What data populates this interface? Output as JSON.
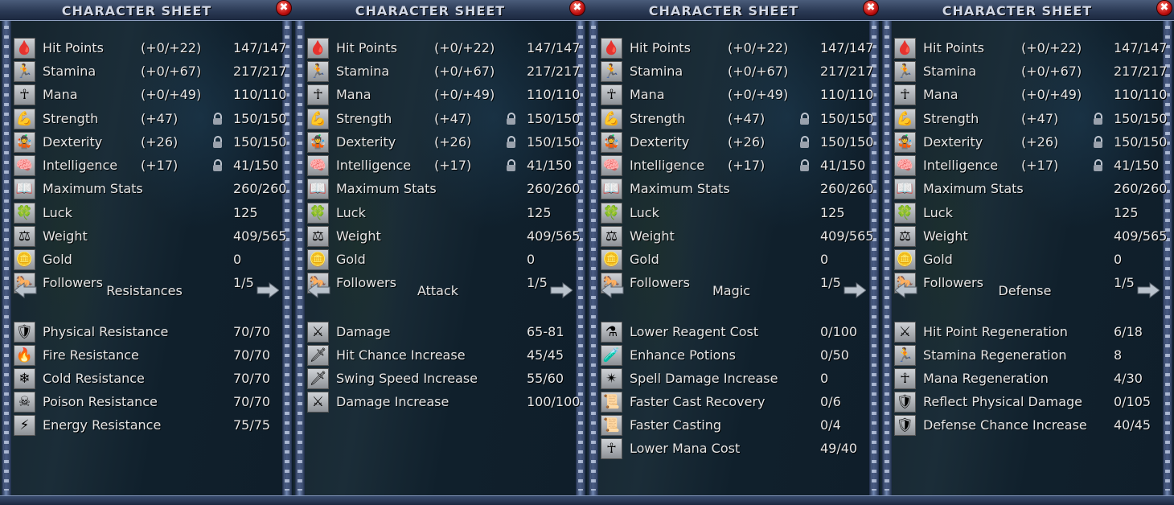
{
  "title": "CHARACTER SHEET",
  "close_symbol": "✖",
  "panels": [
    {
      "stats": [
        {
          "icon": "blood-drop-icon",
          "glyph": "🩸",
          "label": "Hit Points",
          "mod": "(+0/+22)",
          "value": "147/147"
        },
        {
          "icon": "running-figure-icon",
          "glyph": "🏃",
          "label": "Stamina",
          "mod": "(+0/+67)",
          "value": "217/217"
        },
        {
          "icon": "ankh-icon",
          "glyph": "☥",
          "label": "Mana",
          "mod": "(+0/+49)",
          "value": "110/110"
        },
        {
          "icon": "flexed-arm-icon",
          "glyph": "💪",
          "label": "Strength",
          "mod": "(+47)",
          "lock": true,
          "value": "150/150"
        },
        {
          "icon": "juggling-hands-icon",
          "glyph": "🤹",
          "label": "Dexterity",
          "mod": "(+26)",
          "lock": true,
          "value": "150/150"
        },
        {
          "icon": "brain-icon",
          "glyph": "🧠",
          "label": "Intelligence",
          "mod": "(+17)",
          "lock": true,
          "value": "41/150"
        },
        {
          "icon": "open-book-icon",
          "glyph": "📖",
          "label": "Maximum Stats",
          "mod": "",
          "value": "260/260"
        },
        {
          "icon": "four-leaf-clover-icon",
          "glyph": "🍀",
          "label": "Luck",
          "mod": "",
          "value": "125"
        },
        {
          "icon": "weight-icon",
          "glyph": "⚖",
          "label": "Weight",
          "mod": "",
          "value": "409/565"
        },
        {
          "icon": "gold-coins-icon",
          "glyph": "🪙",
          "label": "Gold",
          "mod": "",
          "value": "0"
        },
        {
          "icon": "horse-icon",
          "glyph": "🐎",
          "label": "Followers",
          "mod": "",
          "value": "1/5"
        }
      ],
      "section": "Resistances",
      "props": [
        {
          "icon": "shield-icon",
          "glyph": "🛡",
          "label": "Physical Resistance",
          "value": "70/70"
        },
        {
          "icon": "fire-icon",
          "glyph": "🔥",
          "label": "Fire Resistance",
          "value": "70/70"
        },
        {
          "icon": "snowflake-icon",
          "glyph": "❄",
          "label": "Cold Resistance",
          "value": "70/70"
        },
        {
          "icon": "skull-icon",
          "glyph": "☠",
          "label": "Poison Resistance",
          "value": "70/70"
        },
        {
          "icon": "lightning-icon",
          "glyph": "⚡",
          "label": "Energy Resistance",
          "value": "75/75"
        }
      ]
    },
    {
      "stats": [
        {
          "icon": "blood-drop-icon",
          "glyph": "🩸",
          "label": "Hit Points",
          "mod": "(+0/+22)",
          "value": "147/147"
        },
        {
          "icon": "running-figure-icon",
          "glyph": "🏃",
          "label": "Stamina",
          "mod": "(+0/+67)",
          "value": "217/217"
        },
        {
          "icon": "ankh-icon",
          "glyph": "☥",
          "label": "Mana",
          "mod": "(+0/+49)",
          "value": "110/110"
        },
        {
          "icon": "flexed-arm-icon",
          "glyph": "💪",
          "label": "Strength",
          "mod": "(+47)",
          "lock": true,
          "value": "150/150"
        },
        {
          "icon": "juggling-hands-icon",
          "glyph": "🤹",
          "label": "Dexterity",
          "mod": "(+26)",
          "lock": true,
          "value": "150/150"
        },
        {
          "icon": "brain-icon",
          "glyph": "🧠",
          "label": "Intelligence",
          "mod": "(+17)",
          "lock": true,
          "value": "41/150"
        },
        {
          "icon": "open-book-icon",
          "glyph": "📖",
          "label": "Maximum Stats",
          "mod": "",
          "value": "260/260"
        },
        {
          "icon": "four-leaf-clover-icon",
          "glyph": "🍀",
          "label": "Luck",
          "mod": "",
          "value": "125"
        },
        {
          "icon": "weight-icon",
          "glyph": "⚖",
          "label": "Weight",
          "mod": "",
          "value": "409/565"
        },
        {
          "icon": "gold-coins-icon",
          "glyph": "🪙",
          "label": "Gold",
          "mod": "",
          "value": "0"
        },
        {
          "icon": "horse-icon",
          "glyph": "🐎",
          "label": "Followers",
          "mod": "",
          "value": "1/5"
        }
      ],
      "section": "Attack",
      "props": [
        {
          "icon": "sword-sparkle-icon",
          "glyph": "⚔",
          "label": "Damage",
          "value": "65-81"
        },
        {
          "icon": "sword-icon",
          "glyph": "🗡",
          "label": "Hit Chance Increase",
          "value": "45/45"
        },
        {
          "icon": "swinging-sword-icon",
          "glyph": "🗡",
          "label": "Swing Speed Increase",
          "value": "55/60"
        },
        {
          "icon": "sword-sparkle-icon",
          "glyph": "⚔",
          "label": "Damage Increase",
          "value": "100/100"
        }
      ]
    },
    {
      "stats": [
        {
          "icon": "blood-drop-icon",
          "glyph": "🩸",
          "label": "Hit Points",
          "mod": "(+0/+22)",
          "value": "147/147"
        },
        {
          "icon": "running-figure-icon",
          "glyph": "🏃",
          "label": "Stamina",
          "mod": "(+0/+67)",
          "value": "217/217"
        },
        {
          "icon": "ankh-icon",
          "glyph": "☥",
          "label": "Mana",
          "mod": "(+0/+49)",
          "value": "110/110"
        },
        {
          "icon": "flexed-arm-icon",
          "glyph": "💪",
          "label": "Strength",
          "mod": "(+47)",
          "lock": true,
          "value": "150/150"
        },
        {
          "icon": "juggling-hands-icon",
          "glyph": "🤹",
          "label": "Dexterity",
          "mod": "(+26)",
          "lock": true,
          "value": "150/150"
        },
        {
          "icon": "brain-icon",
          "glyph": "🧠",
          "label": "Intelligence",
          "mod": "(+17)",
          "lock": true,
          "value": "41/150"
        },
        {
          "icon": "open-book-icon",
          "glyph": "📖",
          "label": "Maximum Stats",
          "mod": "",
          "value": "260/260"
        },
        {
          "icon": "four-leaf-clover-icon",
          "glyph": "🍀",
          "label": "Luck",
          "mod": "",
          "value": "125"
        },
        {
          "icon": "weight-icon",
          "glyph": "⚖",
          "label": "Weight",
          "mod": "",
          "value": "409/565"
        },
        {
          "icon": "gold-coins-icon",
          "glyph": "🪙",
          "label": "Gold",
          "mod": "",
          "value": "0"
        },
        {
          "icon": "horse-icon",
          "glyph": "🐎",
          "label": "Followers",
          "mod": "",
          "value": "1/5"
        }
      ],
      "section": "Magic",
      "props": [
        {
          "icon": "reagent-icon",
          "glyph": "⚗",
          "label": "Lower Reagent Cost",
          "value": "0/100"
        },
        {
          "icon": "potion-icon",
          "glyph": "🧪",
          "label": "Enhance Potions",
          "value": "0/50"
        },
        {
          "icon": "spell-burst-icon",
          "glyph": "✴",
          "label": "Spell Damage Increase",
          "value": "0"
        },
        {
          "icon": "scroll-icon",
          "glyph": "📜",
          "label": "Faster Cast Recovery",
          "value": "0/6"
        },
        {
          "icon": "scroll-icon",
          "glyph": "📜",
          "label": "Faster Casting",
          "value": "0/4"
        },
        {
          "icon": "ankh-icon",
          "glyph": "☥",
          "label": "Lower Mana Cost",
          "value": "49/40"
        }
      ]
    },
    {
      "stats": [
        {
          "icon": "blood-drop-icon",
          "glyph": "🩸",
          "label": "Hit Points",
          "mod": "(+0/+22)",
          "value": "147/147"
        },
        {
          "icon": "running-figure-icon",
          "glyph": "🏃",
          "label": "Stamina",
          "mod": "(+0/+67)",
          "value": "217/217"
        },
        {
          "icon": "ankh-icon",
          "glyph": "☥",
          "label": "Mana",
          "mod": "(+0/+49)",
          "value": "110/110"
        },
        {
          "icon": "flexed-arm-icon",
          "glyph": "💪",
          "label": "Strength",
          "mod": "(+47)",
          "lock": true,
          "value": "150/150"
        },
        {
          "icon": "juggling-hands-icon",
          "glyph": "🤹",
          "label": "Dexterity",
          "mod": "(+26)",
          "lock": true,
          "value": "150/150"
        },
        {
          "icon": "brain-icon",
          "glyph": "🧠",
          "label": "Intelligence",
          "mod": "(+17)",
          "lock": true,
          "value": "41/150"
        },
        {
          "icon": "open-book-icon",
          "glyph": "📖",
          "label": "Maximum Stats",
          "mod": "",
          "value": "260/260"
        },
        {
          "icon": "four-leaf-clover-icon",
          "glyph": "🍀",
          "label": "Luck",
          "mod": "",
          "value": "125"
        },
        {
          "icon": "weight-icon",
          "glyph": "⚖",
          "label": "Weight",
          "mod": "",
          "value": "409/565"
        },
        {
          "icon": "gold-coins-icon",
          "glyph": "🪙",
          "label": "Gold",
          "mod": "",
          "value": "0"
        },
        {
          "icon": "horse-icon",
          "glyph": "🐎",
          "label": "Followers",
          "mod": "",
          "value": "1/5"
        }
      ],
      "section": "Defense",
      "props": [
        {
          "icon": "sword-sparkle-icon",
          "glyph": "⚔",
          "label": "Hit Point Regeneration",
          "value": "6/18"
        },
        {
          "icon": "running-figure-icon",
          "glyph": "🏃",
          "label": "Stamina Regeneration",
          "value": "8"
        },
        {
          "icon": "ankh-icon",
          "glyph": "☥",
          "label": "Mana Regeneration",
          "value": "4/30"
        },
        {
          "icon": "reflect-shield-icon",
          "glyph": "🛡",
          "label": "Reflect Physical Damage",
          "value": "0/105"
        },
        {
          "icon": "shield-sparkle-icon",
          "glyph": "🛡",
          "label": "Defense Chance Increase",
          "value": "40/45"
        }
      ]
    }
  ]
}
